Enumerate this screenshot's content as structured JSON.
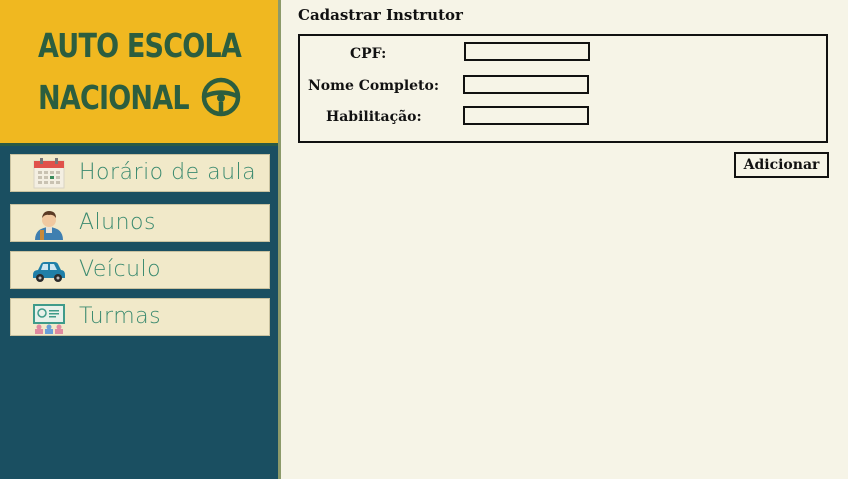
{
  "brand": {
    "line1": "AUTO ESCOLA",
    "line2": "NACIONAL",
    "icon": "steering-wheel-icon"
  },
  "colors": {
    "sidebar": "#1a4f61",
    "brand_bg": "#f0b820",
    "brand_text": "#2c5e3f",
    "nav_bg": "#f1e9c9",
    "nav_text": "#3b8a6f",
    "page_bg": "#f6f4e7"
  },
  "nav": {
    "items": [
      {
        "label": "Horário de aula",
        "icon": "calendar-icon"
      },
      {
        "label": "Alunos",
        "icon": "student-icon"
      },
      {
        "label": "Veículo",
        "icon": "car-icon"
      },
      {
        "label": "Turmas",
        "icon": "classroom-icon"
      }
    ]
  },
  "main": {
    "title": "Cadastrar Instrutor",
    "form": {
      "cpf_label": "CPF:",
      "cpf_value": "",
      "nome_label": "Nome Completo:",
      "nome_value": "",
      "habilitacao_label": "Habilitação:",
      "habilitacao_value": ""
    },
    "add_button": "Adicionar"
  }
}
